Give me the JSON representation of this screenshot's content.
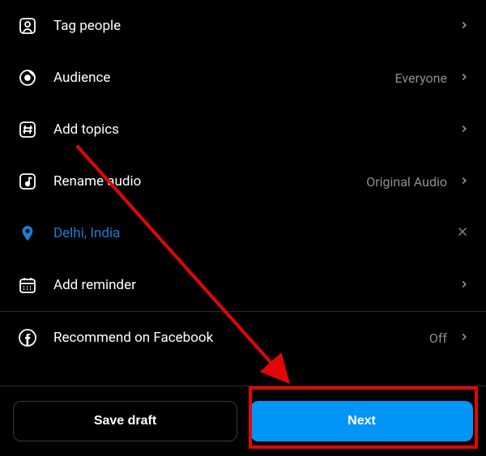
{
  "options": [
    {
      "label": "Tag people",
      "value": null,
      "action": "chevron",
      "highlighted": false,
      "icon": "tag-people"
    },
    {
      "label": "Audience",
      "value": "Everyone",
      "action": "chevron",
      "highlighted": false,
      "icon": "audience"
    },
    {
      "label": "Add topics",
      "value": null,
      "action": "chevron",
      "highlighted": false,
      "icon": "hashtag"
    },
    {
      "label": "Rename audio",
      "value": "Original Audio",
      "action": "chevron",
      "highlighted": false,
      "icon": "audio"
    },
    {
      "label": "Delhi, India",
      "value": null,
      "action": "close",
      "highlighted": true,
      "icon": "location"
    },
    {
      "label": "Add reminder",
      "value": null,
      "action": "chevron",
      "highlighted": false,
      "icon": "calendar"
    },
    {
      "label": "Recommend on Facebook",
      "value": "Off",
      "action": "chevron",
      "highlighted": false,
      "icon": "facebook"
    }
  ],
  "buttons": {
    "save_draft": "Save draft",
    "next": "Next"
  },
  "colors": {
    "accent": "#1a7dd6",
    "primary_button": "#0095f6",
    "highlight_border": "#e00707",
    "muted": "#8e8e8e"
  }
}
